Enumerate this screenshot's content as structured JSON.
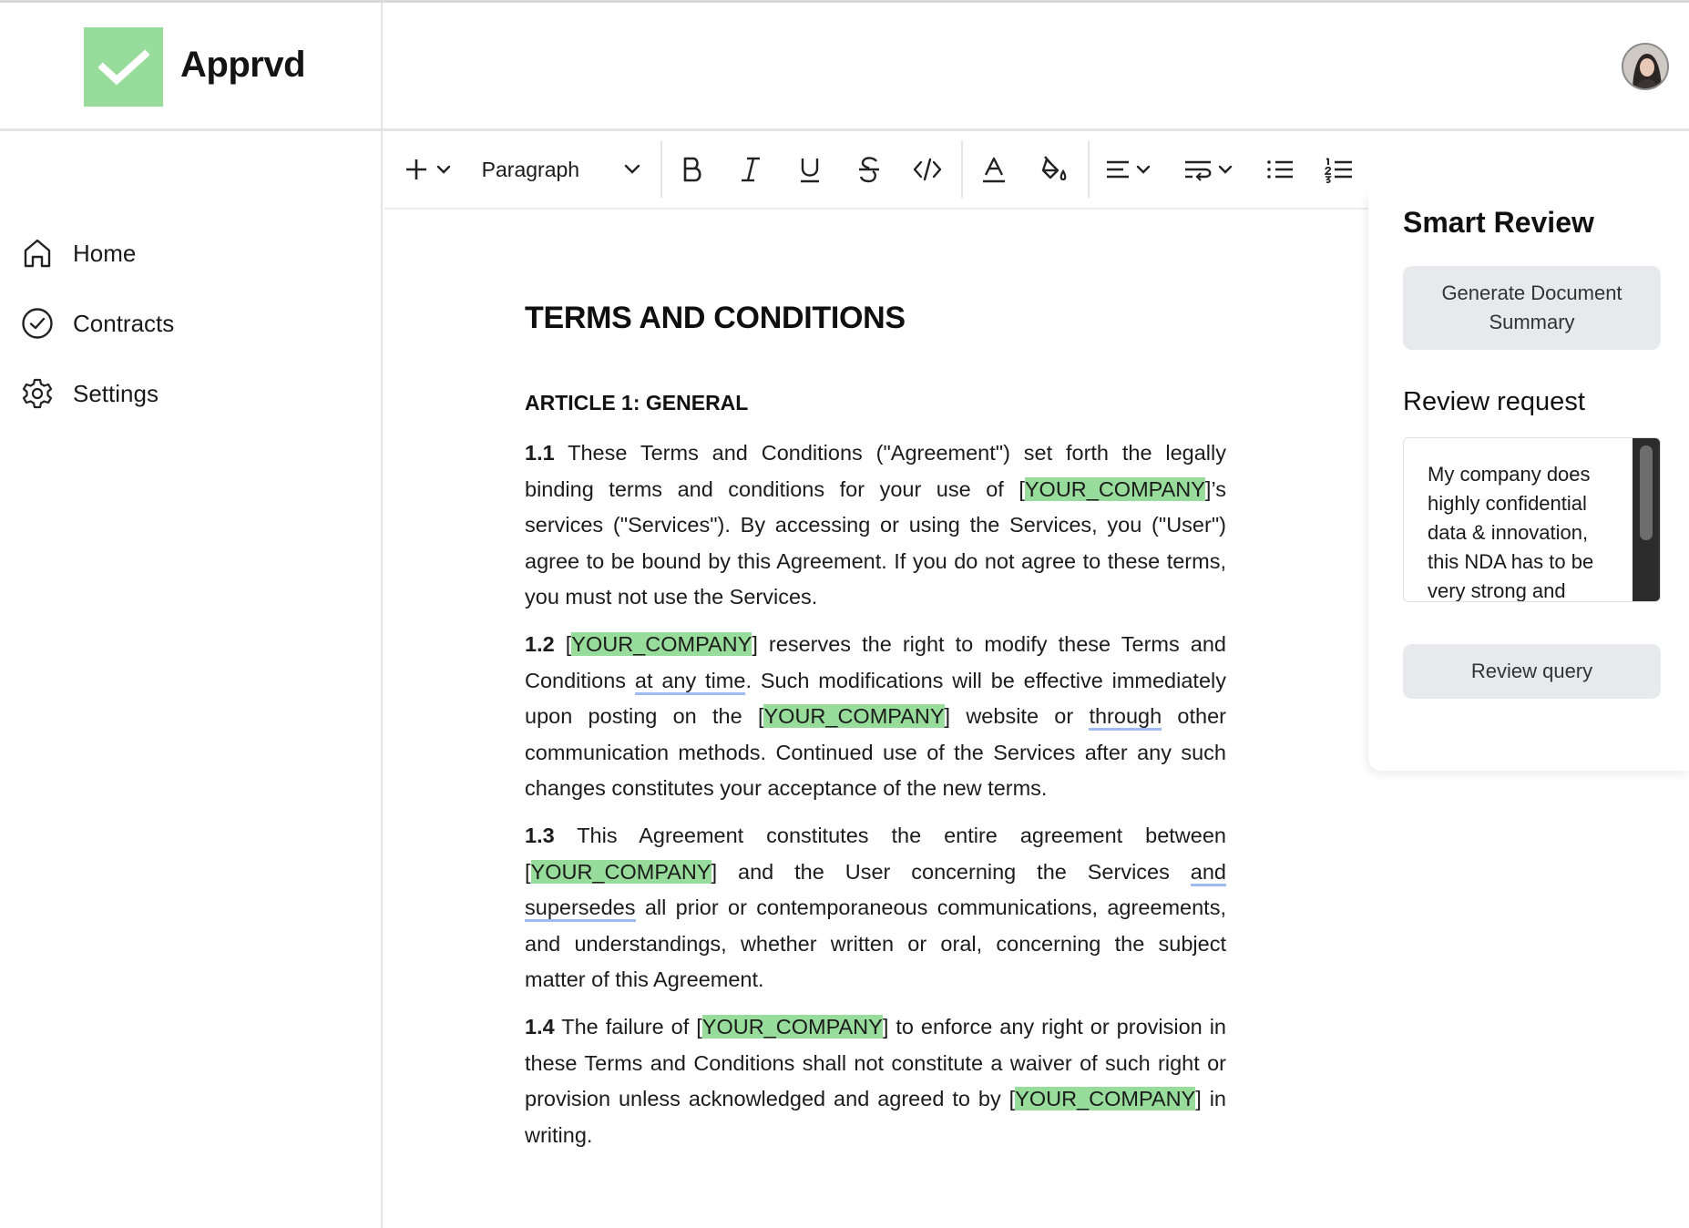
{
  "app": {
    "name": "Apprvd"
  },
  "sidebar": {
    "items": [
      {
        "label": "Home",
        "icon": "home-icon"
      },
      {
        "label": "Contracts",
        "icon": "check-circle-icon"
      },
      {
        "label": "Settings",
        "icon": "gear-icon"
      }
    ]
  },
  "toolbar": {
    "block_type": "Paragraph",
    "buttons": [
      "insert",
      "bold",
      "italic",
      "underline",
      "strikethrough",
      "code",
      "font-color",
      "highlight",
      "align",
      "text-wrap",
      "bullet-list",
      "numbered-list"
    ]
  },
  "document": {
    "title": "TERMS AND CONDITIONS",
    "article_heading": "ARTICLE 1: GENERAL",
    "placeholder": "YOUR_COMPANY",
    "p1": {
      "num": "1.1",
      "t1": " These Terms and Conditions (\"Agreement\") set forth the legally binding terms and conditions for your use of [",
      "t2": "]’s services (\"Services\"). By accessing or using the Services, you (\"User\") agree to be bound by this Agreement. If you do not agree to these terms, you must not use the Services."
    },
    "p2": {
      "num": "1.2",
      "t1": " [",
      "t2": "] reserves the right to modify these Terms and Conditions ",
      "u1": "at any time",
      "t3": ". Such modifications will be effective immediately upon posting on the [",
      "t4": "] website or ",
      "u2": "through",
      "t5": " other communication methods. Continued use of the Services after any such changes constitutes your acceptance of the new terms."
    },
    "p3": {
      "num": "1.3",
      "t1": " This Agreement constitutes the entire agreement between [",
      "t2": "] and the User concerning the Services ",
      "u1": "and supersedes",
      "t3": " all prior or contemporaneous communications, agreements, and understandings, whether written or oral, concerning the subject matter of this Agreement."
    },
    "p4": {
      "num": "1.4",
      "t1": " The failure of [",
      "t2": "] to enforce any right or provision in these Terms and Conditions shall not constitute a waiver of such right or provision unless acknowledged and agreed to by [",
      "t3": "] in writing."
    }
  },
  "smart_review": {
    "title": "Smart Review",
    "generate_button": "Generate Document Summary",
    "review_request_title": "Review request",
    "request_text": "My company does highly confidential data & innovation, this NDA has to be very strong and",
    "review_button": "Review query"
  },
  "colors": {
    "logo_green": "#97dc9b",
    "highlight_green": "#97dc9b",
    "underline_blue": "#9fb9f2",
    "button_gray": "#e7e9ec"
  }
}
